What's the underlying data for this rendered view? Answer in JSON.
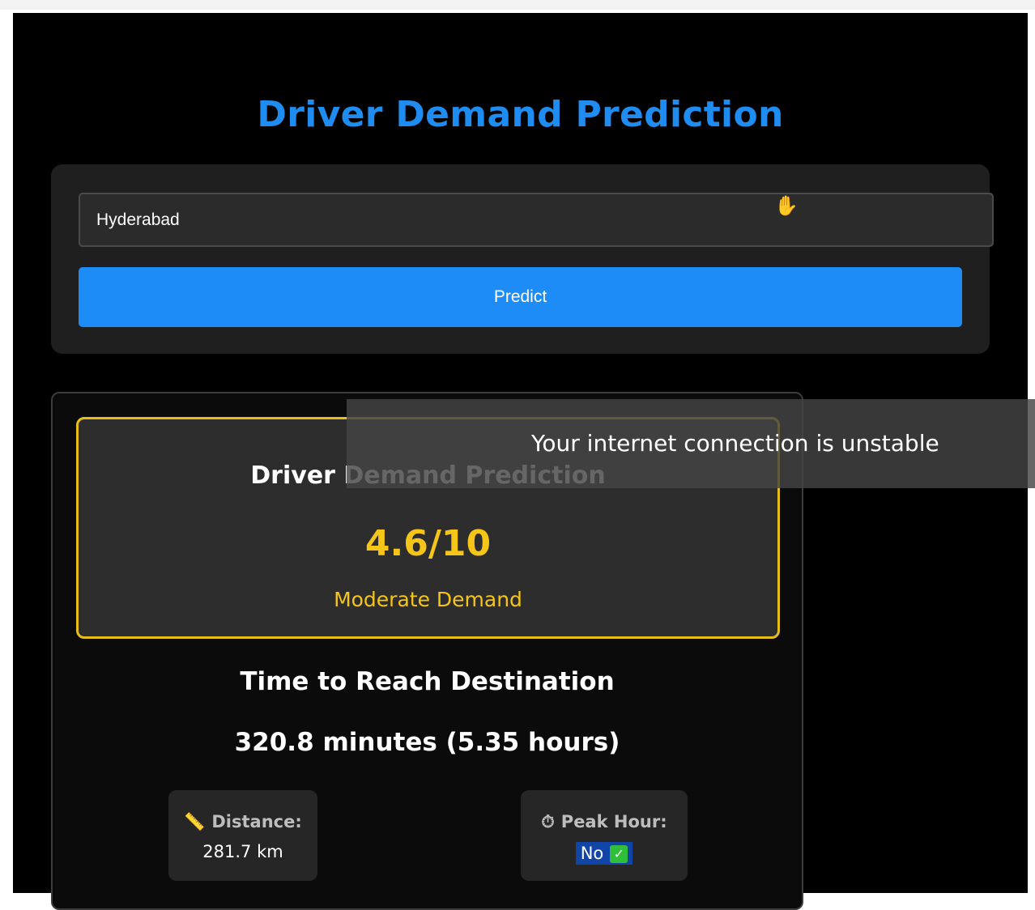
{
  "app": {
    "title": "Driver Demand Prediction"
  },
  "form": {
    "city_value": "Hyderabad",
    "predict_label": "Predict"
  },
  "result": {
    "demand_title": "Driver Demand Prediction",
    "score": "4.6/10",
    "level": "Moderate Demand",
    "eta_title": "Time to Reach Destination",
    "eta_value": "320.8 minutes (5.35 hours)",
    "distance": {
      "icon": "ruler-icon",
      "label": "Distance:",
      "value": "281.7 km"
    },
    "peak_hour": {
      "icon": "stopwatch-icon",
      "label": "Peak Hour:",
      "value": "No",
      "check_icon": "check-mark-icon"
    }
  },
  "toast": {
    "message": "Your internet connection is unstable"
  },
  "colors": {
    "accent": "#1e8cf7",
    "demand_highlight": "#f5c518",
    "background": "#000000"
  }
}
